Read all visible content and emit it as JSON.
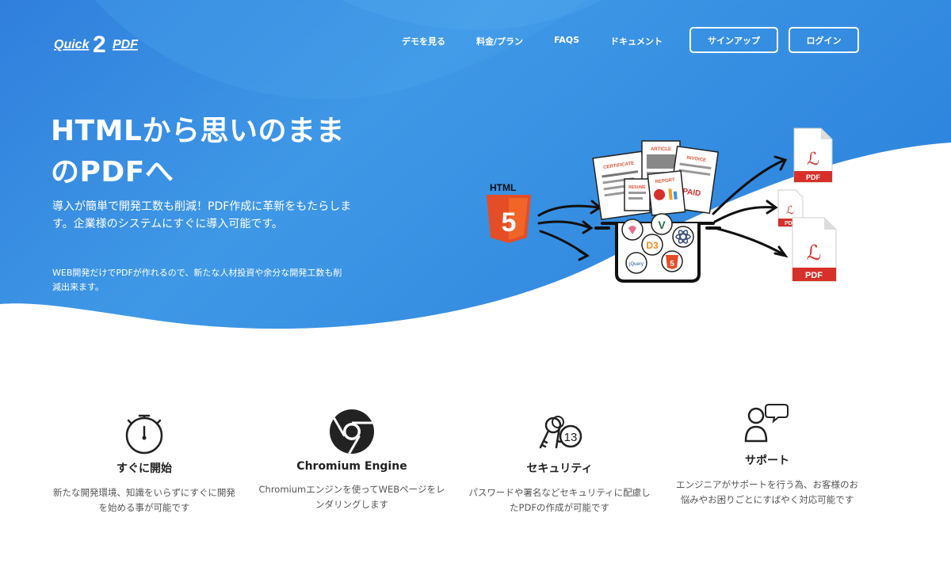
{
  "brand": {
    "logo_text_left": "Quick",
    "logo_text_mid": "2",
    "logo_text_right": "PDF"
  },
  "nav": {
    "links": [
      "デモを見る",
      "料金/プラン",
      "FAQS",
      "ドキュメント"
    ],
    "signup": "サインアップ",
    "login": "ログイン"
  },
  "hero": {
    "headline_line1": "HTMLから思いのまま",
    "headline_line2": "のPDFへ",
    "lead": "導入が簡単で開発工数も削減！PDF作成に革新をもたらします。企業様のシステムにすぐに導入可能です。",
    "sub": "WEB開発だけでPDFが作れるので、新たな人材投資や余分な開発工数も削減出来ます。"
  },
  "illustration": {
    "html5_label": "HTML",
    "html5_number": "5",
    "docs": [
      "CERTIFICATE",
      "ARTICLE",
      "INVOICE",
      "RESUME",
      "REPORT",
      "PAID"
    ],
    "pdf_labels": [
      "PDF",
      "PDF",
      "PDF"
    ],
    "pot_logos": [
      "V",
      "D3",
      "5",
      "jQuery"
    ]
  },
  "features": [
    {
      "icon": "stopwatch-icon",
      "title": "すぐに開始",
      "desc": "新たな開発環境、知識をいらずにすぐに開発を始める事が可能です"
    },
    {
      "icon": "chromium-icon",
      "title": "Chromium Engine",
      "desc": "Chromiumエンジンを使ってWEBページをレンダリングします"
    },
    {
      "icon": "keys-icon",
      "title": "セキュリティ",
      "desc": "パスワードや署名などセキュリティに配慮したPDFの作成が可能です",
      "badge": "13"
    },
    {
      "icon": "support-icon",
      "title": "サポート",
      "desc": "エンジニアがサポートを行う為、お客様のお悩みやお困りごとにすばやく対応可能です"
    }
  ],
  "colors": {
    "hero_blue": "#3b8fe0",
    "hero_light": "#4aa3ea",
    "pdf_red": "#d7302a",
    "html5_orange": "#e44d26"
  }
}
